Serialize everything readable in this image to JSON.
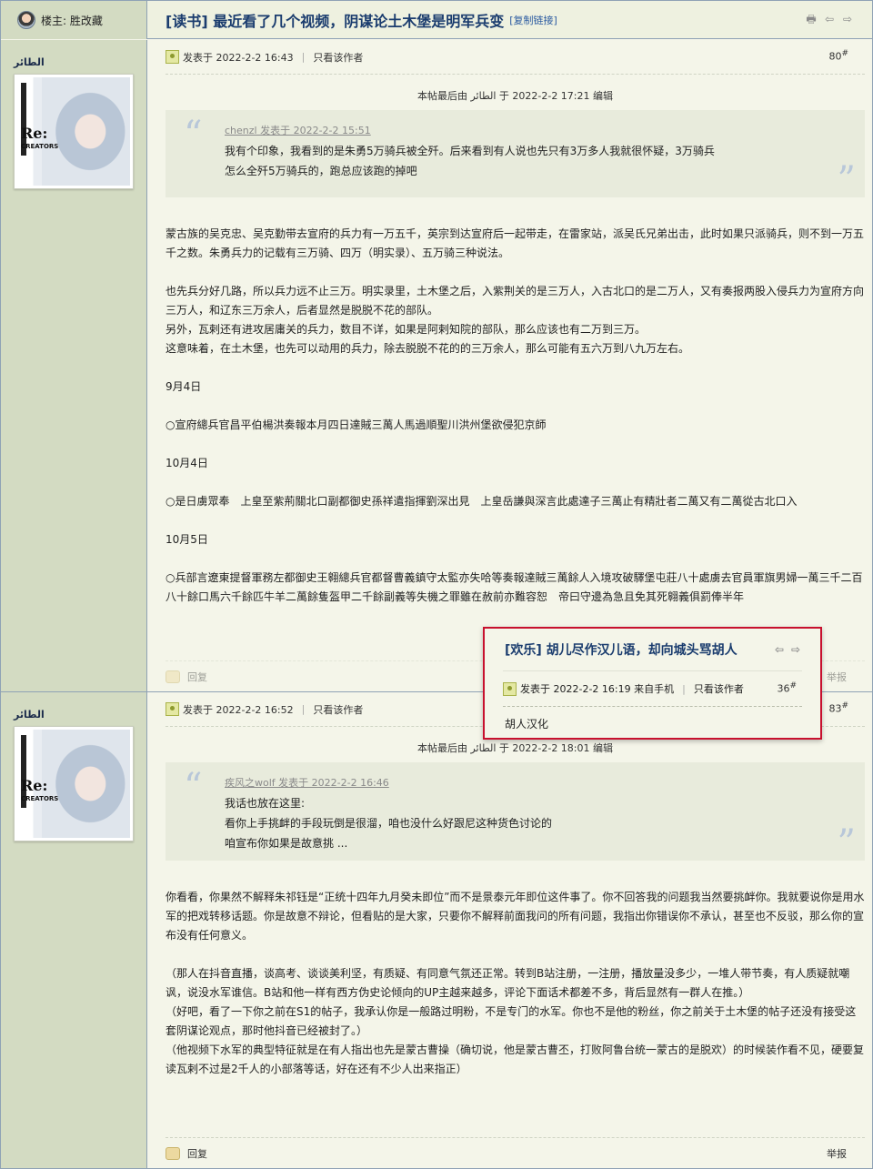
{
  "header": {
    "author_label": "楼主: 胜改藏",
    "title": "[读书] 最近看了几个视频，阴谋论土木堡是明军兵变",
    "copy_link": "[复制链接]"
  },
  "posts": [
    {
      "username": "الطائر",
      "posted": "发表于 2022-2-2 16:43",
      "only_author": "只看该作者",
      "floor": "80",
      "edit_note": "本帖最后由 الطائر 于 2022-2-2 17:21 编辑",
      "quote": {
        "head": "chenzl 发表于 2022-2-2 15:51",
        "lines": [
          "我有个印象，我看到的是朱勇5万骑兵被全歼。后来看到有人说也先只有3万多人我就很怀疑，3万骑兵",
          "怎么全歼5万骑兵的，跑总应该跑的掉吧"
        ]
      },
      "body": [
        "蒙古族的吴克忠、吴克勤带去宣府的兵力有一万五千，英宗到达宣府后一起带走，在雷家站，派吴氏兄弟出击，此时如果只派骑兵，则不到一万五千之数。朱勇兵力的记载有三万骑、四万（明实录）、五万骑三种说法。",
        "",
        "也先兵分好几路，所以兵力远不止三万。明实录里，土木堡之后，入紫荆关的是三万人，入古北口的是二万人，又有奏报两股入侵兵力为宣府方向三万人，和辽东三万余人，后者显然是脱脱不花的部队。",
        "另外，瓦剌还有进攻居庸关的兵力，数目不详，如果是阿剌知院的部队，那么应该也有二万到三万。",
        "这意味着，在土木堡，也先可以动用的兵力，除去脱脱不花的的三万余人，那么可能有五六万到八九万左右。",
        "",
        "9月4日",
        "",
        "○宣府總兵官昌平伯楊洪奏報本月四日達賊三萬人馬過順聖川洪州堡欲侵犯京師",
        "",
        "10月4日",
        "",
        "○是日虜眾奉　上皇至紫荊關北口副都御史孫祥遣指揮劉深出見　上皇岳謙與深言此處達子三萬止有精壯者二萬又有二萬從古北口入",
        "",
        "10月5日",
        "",
        "○兵部言遼東提督軍務左都御史王翱總兵官都督曹義鎮守太監亦失哈等奏報達賊三萬餘人入境攻破驛堡屯莊八十處虜去官員軍旗男婦一萬三千二百八十餘口馬六千餘匹牛羊二萬餘隻盔甲二千餘副義等失機之罪雖在赦前亦難容恕　帝曰守邊為急且免其死翱義俱罰俸半年"
      ],
      "reply": "回复",
      "report": "举报"
    },
    {
      "username": "الطائر",
      "posted": "发表于 2022-2-2 16:52",
      "only_author": "只看该作者",
      "floor": "83",
      "edit_note": "本帖最后由 الطائر 于 2022-2-2 18:01 编辑",
      "quote": {
        "head": "疾风之wolf 发表于 2022-2-2 16:46",
        "lines": [
          "我话也放在这里:",
          "看你上手挑衅的手段玩倒是很溜，咱也没什么好跟尼这种货色讨论的",
          "咱宣布你如果是故意挑 ..."
        ]
      },
      "body": [
        "你看看，你果然不解释朱祁钰是“正统十四年九月癸未即位”而不是景泰元年即位这件事了。你不回答我的问题我当然要挑衅你。我就要说你是用水军的把戏转移话题。你是故意不辩论，但看贴的是大家，只要你不解释前面我问的所有问题，我指出你错误你不承认，甚至也不反驳，那么你的宣布没有任何意义。",
        "",
        "（那人在抖音直播，谈高考、谈谈美利坚，有质疑、有同意气氛还正常。转到B站注册，一注册，播放量没多少，一堆人带节奏，有人质疑就嘲讽，说没水军谁信。B站和他一样有西方伪史论倾向的UP主越来越多，评论下面话术都差不多，背后显然有一群人在推。）",
        "（好吧，看了一下你之前在S1的帖子，我承认你是一般路过明粉，不是专门的水军。你也不是他的粉丝，你之前关于土木堡的帖子还没有接受这套阴谋论观点，那时他抖音已经被封了。）",
        "（他视频下水军的典型特征就是在有人指出也先是蒙古曹操（确切说，他是蒙古曹丕，打败阿鲁台统一蒙古的是脱欢）的时候装作看不见，硬要复读瓦剌不过是2千人的小部落等话，好在还有不少人出来指正）"
      ],
      "reply": "回复",
      "report": "举报"
    }
  ],
  "popup": {
    "title": "[欢乐] 胡儿尽作汉儿语，却向城头骂胡人",
    "posted": "发表于 2022-2-2 16:19 来自手机",
    "only_author": "只看该作者",
    "floor": "36",
    "body": "胡人汉化"
  },
  "colors": {
    "accent_title": "#1a3c6e",
    "sidebar_bg": "#d3dbc2",
    "post_bg": "#f4f5e9",
    "popup_border": "#c8102e"
  },
  "icons": [
    "print-icon",
    "prev-arrow-icon",
    "next-arrow-icon",
    "online-status-icon",
    "reply-icon"
  ]
}
